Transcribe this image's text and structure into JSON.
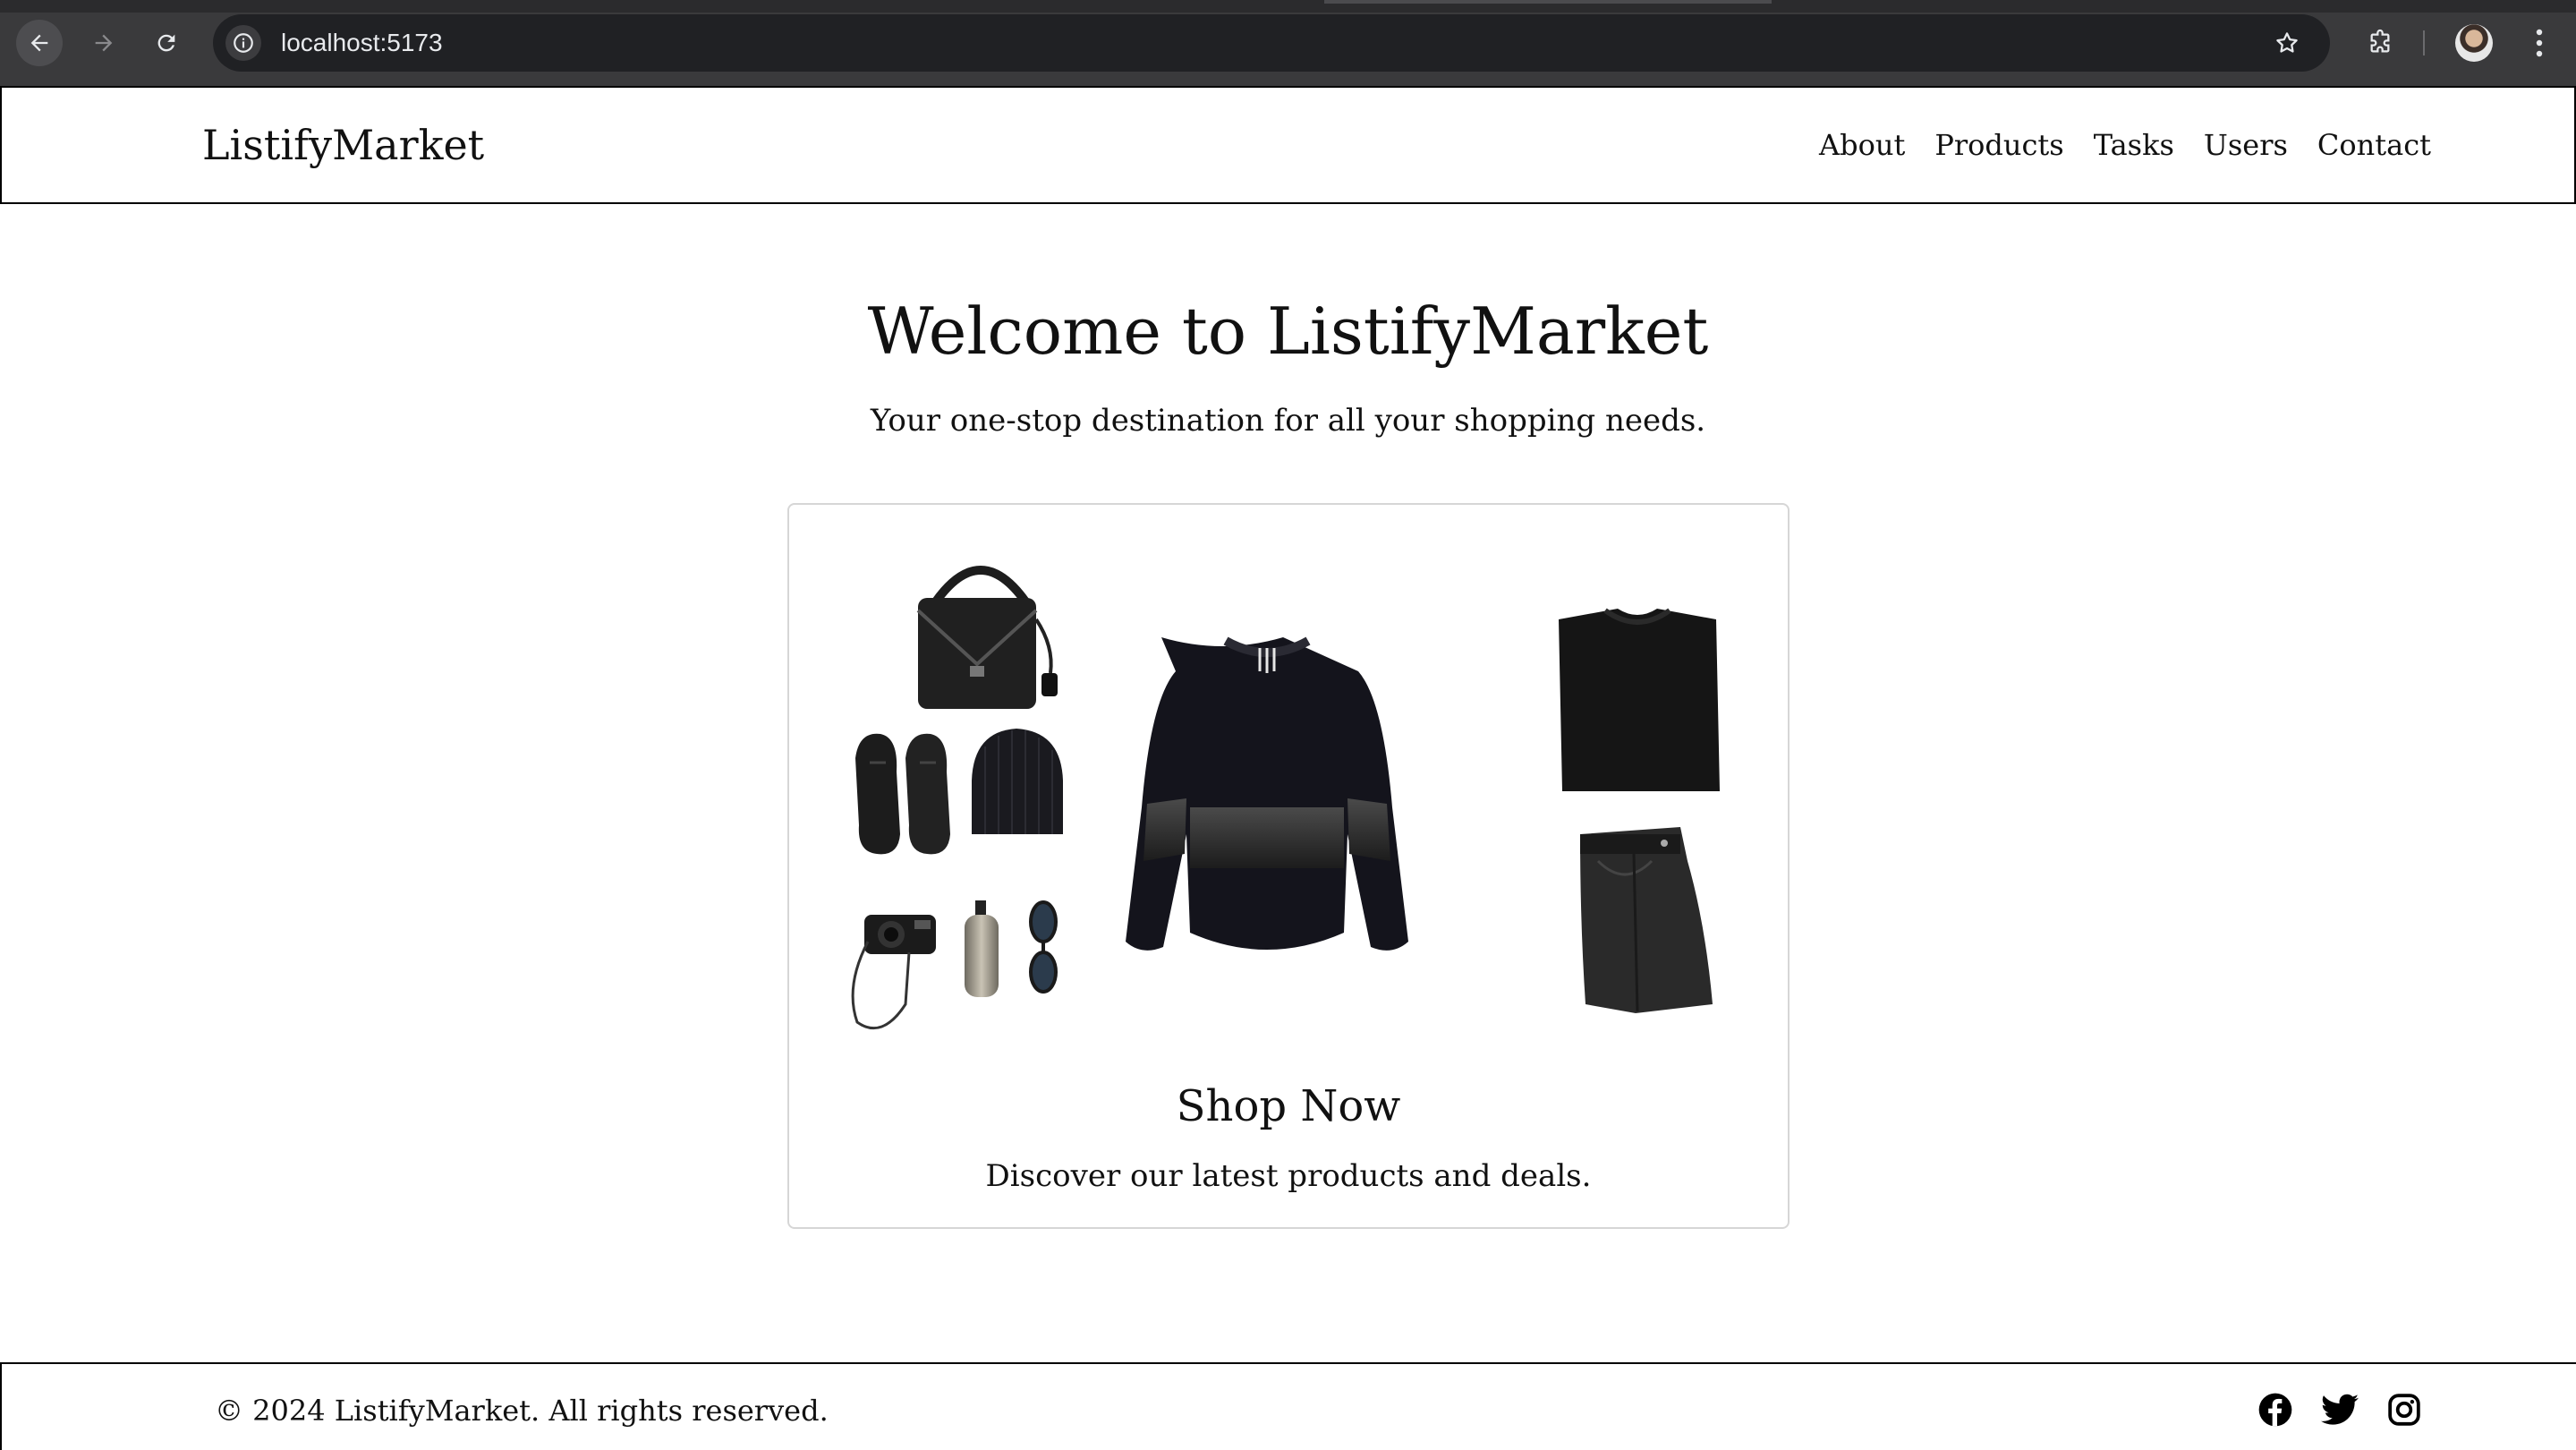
{
  "browser": {
    "url": "localhost:5173"
  },
  "header": {
    "logo": "ListifyMarket",
    "nav": [
      "About",
      "Products",
      "Tasks",
      "Users",
      "Contact"
    ]
  },
  "hero": {
    "title": "Welcome to ListifyMarket",
    "subtitle": "Your one-stop destination for all your shopping needs."
  },
  "card": {
    "title": "Shop Now",
    "text": "Discover our latest products and deals.",
    "image_icon": "clothing-flatlay-image"
  },
  "footer": {
    "copyright": "© 2024 ListifyMarket. All rights reserved.",
    "social_icons": [
      "facebook-icon",
      "twitter-icon",
      "instagram-icon"
    ]
  },
  "colors": {
    "chrome_bg": "#3a3a3c",
    "omnibox_bg": "#202124",
    "page_bg": "#ffffff",
    "text": "#111111",
    "card_border": "#d6d6d6"
  }
}
